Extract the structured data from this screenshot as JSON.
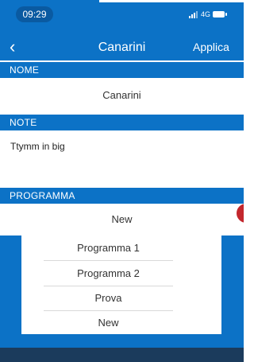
{
  "status_bar": {
    "time": "09:29",
    "network": "4G"
  },
  "nav": {
    "back_label": "‹",
    "title": "Canarini",
    "apply_label": "Applica"
  },
  "sections": {
    "nome": {
      "header": "NOME",
      "value": "Canarini"
    },
    "note": {
      "header": "NOTE",
      "value": "Ttymm in big"
    },
    "programma": {
      "header": "PROGRAMMA",
      "value": "New"
    }
  },
  "dropdown": {
    "options": [
      "Programma 1",
      "Programma 2",
      "Prova",
      "New"
    ]
  },
  "colors": {
    "primary": "#0c72c6",
    "badge": "#c3272d"
  }
}
